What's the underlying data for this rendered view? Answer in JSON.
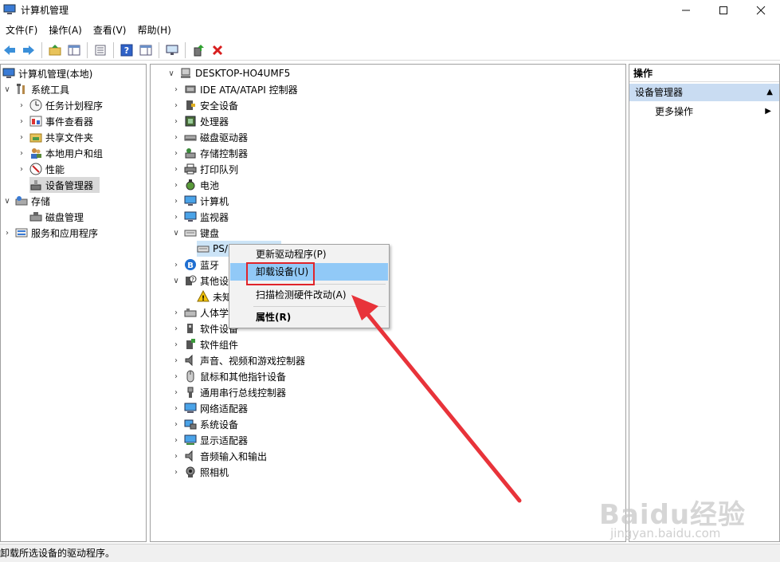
{
  "window": {
    "title": "计算机管理",
    "min_icon": "minimize-icon",
    "max_icon": "maximize-icon",
    "close_icon": "close-icon"
  },
  "menu": [
    "文件(F)",
    "操作(A)",
    "查看(V)",
    "帮助(H)"
  ],
  "left_tree": {
    "root": "计算机管理(本地)",
    "system_tools": "系统工具",
    "task_scheduler": "任务计划程序",
    "event_viewer": "事件查看器",
    "shared_folders": "共享文件夹",
    "local_users": "本地用户和组",
    "performance": "性能",
    "device_manager": "设备管理器",
    "storage": "存储",
    "disk_management": "磁盘管理",
    "services_apps": "服务和应用程序"
  },
  "device_tree": {
    "computer_name": "DESKTOP-HO4UMF5",
    "categories": [
      "IDE ATA/ATAPI 控制器",
      "安全设备",
      "处理器",
      "磁盘驱动器",
      "存储控制器",
      "打印队列",
      "电池",
      "计算机",
      "监视器",
      "键盘"
    ],
    "keyboard_child": "PS/",
    "after_keyboard": {
      "bluetooth": "蓝牙",
      "other_devices": "其他设",
      "unknown_device": "未知",
      "hid": "人体学",
      "software_devices": "软件设备"
    },
    "rest": [
      "软件组件",
      "声音、视频和游戏控制器",
      "鼠标和其他指针设备",
      "通用串行总线控制器",
      "网络适配器",
      "系统设备",
      "显示适配器",
      "音频输入和输出",
      "照相机"
    ]
  },
  "context_menu": {
    "update_driver": "更新驱动程序(P)",
    "uninstall": "卸载设备(U)",
    "scan": "扫描检测硬件改动(A)",
    "properties": "属性(R)"
  },
  "actions": {
    "header": "操作",
    "section": "设备管理器",
    "more": "更多操作"
  },
  "status_text": "卸载所选设备的驱动程序。",
  "watermark": {
    "main": "Baidu经验",
    "sub": "jingyan.baidu.com"
  },
  "colors": {
    "highlight": "#91c9f7",
    "annotation_red": "#e0242a",
    "actions_section": "#c9dcf2"
  }
}
